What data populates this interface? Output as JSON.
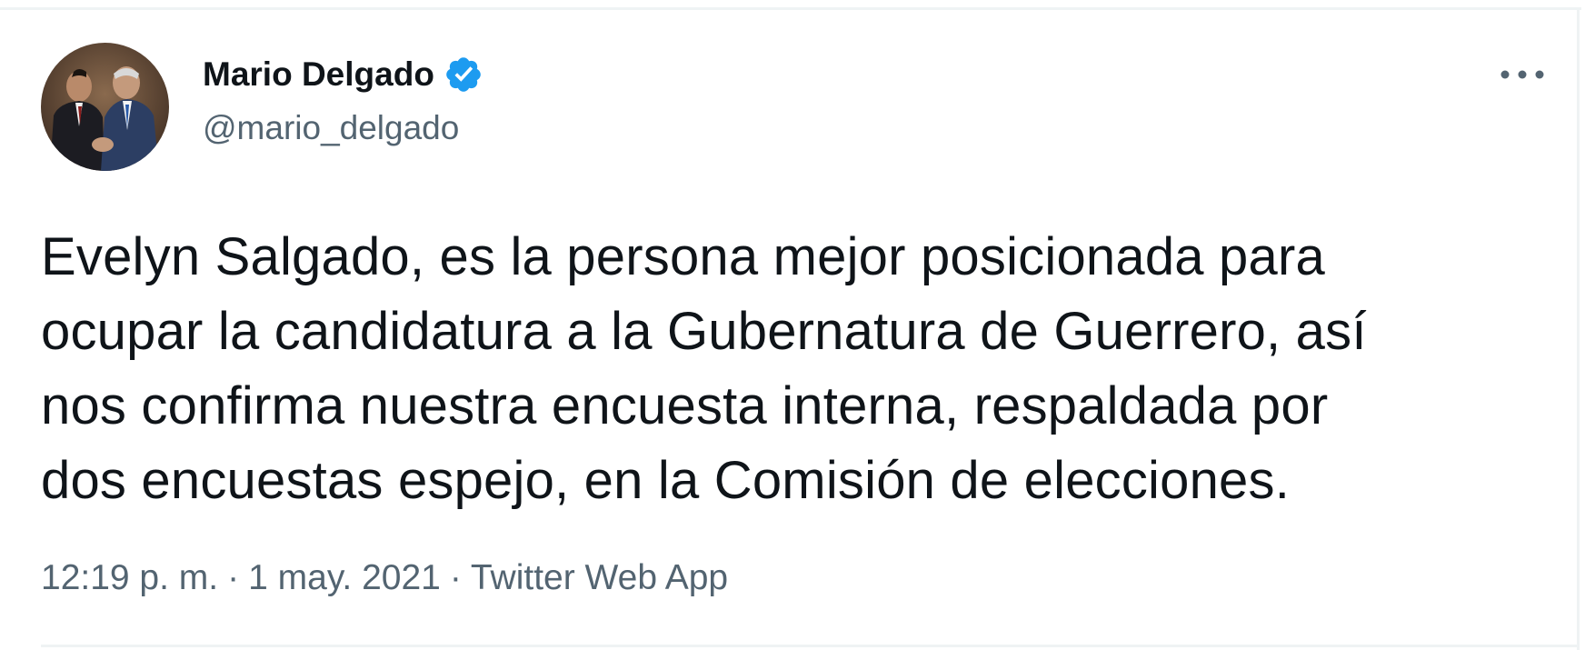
{
  "author": {
    "display_name": "Mario Delgado",
    "handle": "@mario_delgado",
    "verified": true,
    "avatar_icon": "avatar-photo"
  },
  "tweet": {
    "lines": [
      "Evelyn Salgado, es la persona mejor posicionada para",
      "ocupar la candidatura a la Gubernatura de Guerrero, así",
      "nos confirma nuestra encuesta interna, respaldada por",
      "dos encuestas espejo, en la Comisión de elecciones."
    ]
  },
  "meta": {
    "time": "12:19 p. m.",
    "separator": "·",
    "date": "1 may. 2021",
    "source": "Twitter Web App"
  },
  "icons": {
    "verified": "verified-badge-icon",
    "more": "more-options-icon"
  },
  "colors": {
    "text_primary": "#0f1419",
    "text_secondary": "#536471",
    "verified_blue": "#1d9bf0",
    "border": "#eff3f4"
  }
}
